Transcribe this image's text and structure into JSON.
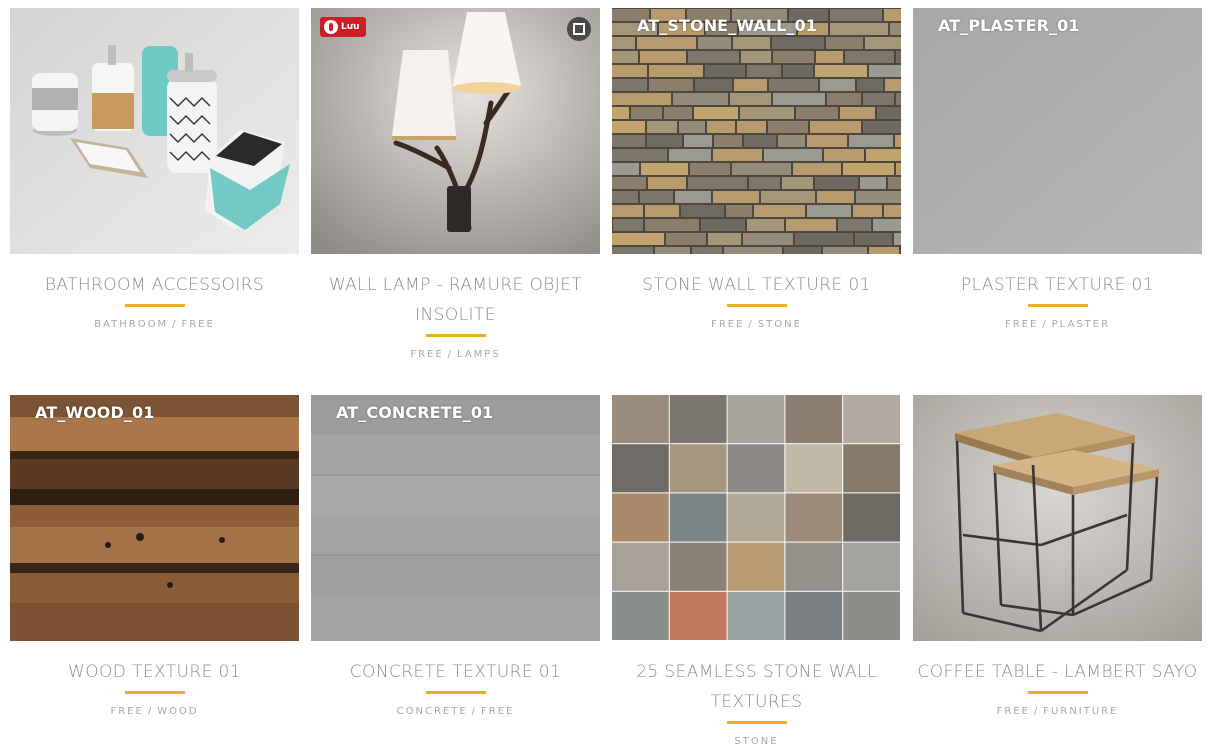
{
  "products": [
    {
      "title": "BATHROOM ACCESSOIRS",
      "overlay": "",
      "categories": [
        "BATHROOM",
        "FREE"
      ]
    },
    {
      "title": "WALL LAMP - RAMURE OBJET INSOLITE",
      "overlay": "",
      "categories": [
        "FREE",
        "LAMPS"
      ]
    },
    {
      "title": "STONE WALL TEXTURE 01",
      "overlay": "AT_STONE_WALL_01",
      "categories": [
        "FREE",
        "STONE"
      ]
    },
    {
      "title": "PLASTER TEXTURE 01",
      "overlay": "AT_PLASTER_01",
      "categories": [
        "FREE",
        "PLASTER"
      ]
    },
    {
      "title": "WOOD TEXTURE 01",
      "overlay": "AT_WOOD_01",
      "categories": [
        "FREE",
        "WOOD"
      ]
    },
    {
      "title": "CONCRETE TEXTURE 01",
      "overlay": "AT_CONCRETE_01",
      "categories": [
        "CONCRETE",
        "FREE"
      ]
    },
    {
      "title": "25 SEAMLESS STONE WALL TEXTURES",
      "overlay": "",
      "categories": [
        "STONE"
      ]
    },
    {
      "title": "COFFEE TABLE - LAMBERT SAYO",
      "overlay": "",
      "categories": [
        "FREE",
        "FURNITURE"
      ]
    }
  ],
  "pinterest_button": {
    "label": "Lưu",
    "icon": "pinterest-icon"
  },
  "expand_button": {
    "icon": "expand-icon"
  },
  "category_separator": "/",
  "colors": {
    "accent_bar": "#e6b422",
    "title_text": "#8c8c8c",
    "category_text": "#a8a8a8",
    "pinterest": "#cb1f27"
  }
}
